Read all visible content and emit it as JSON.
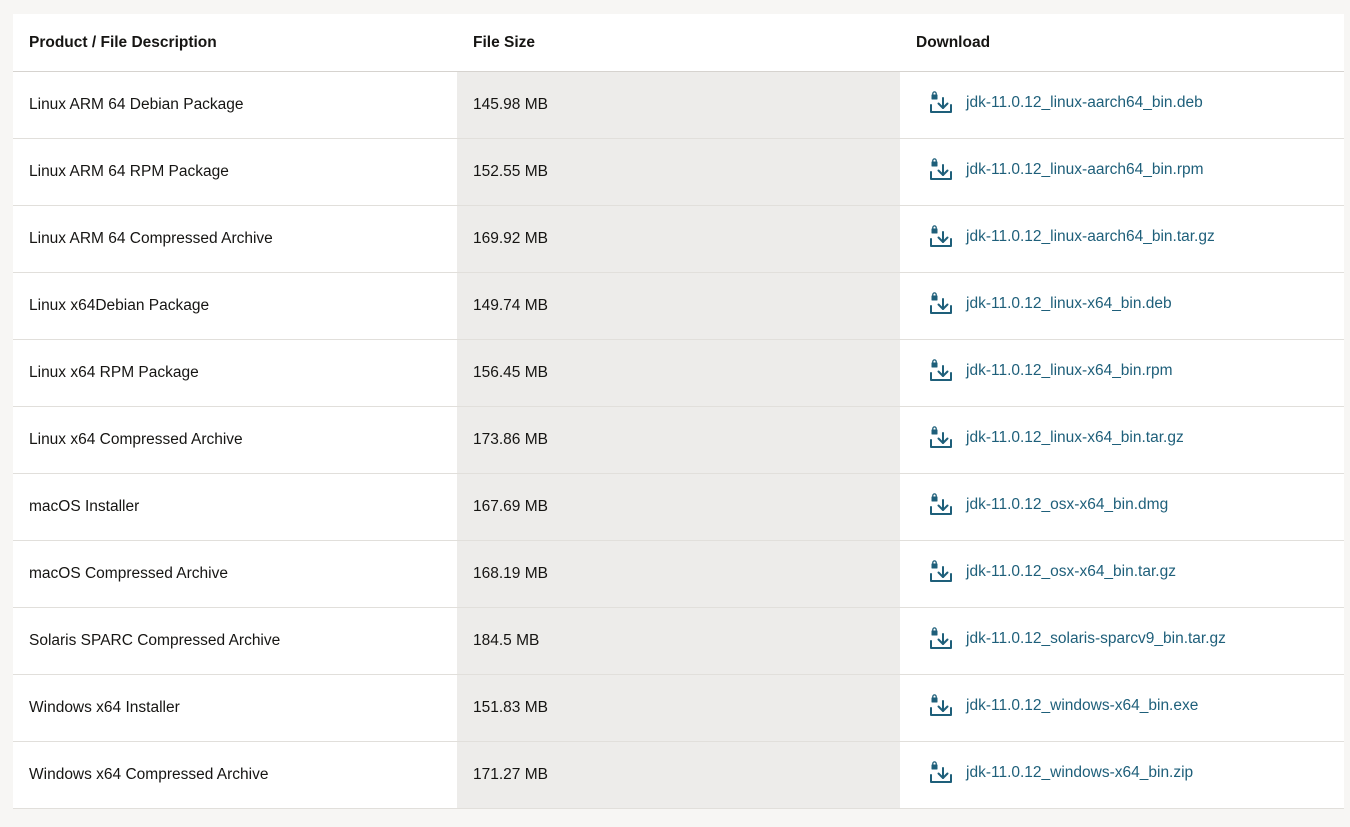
{
  "table": {
    "headers": {
      "description": "Product / File Description",
      "size": "File Size",
      "download": "Download"
    },
    "rows": [
      {
        "description": "Linux ARM 64 Debian Package",
        "size": "145.98 MB",
        "file": "jdk-11.0.12_linux-aarch64_bin.deb"
      },
      {
        "description": "Linux ARM 64 RPM Package",
        "size": "152.55 MB",
        "file": "jdk-11.0.12_linux-aarch64_bin.rpm"
      },
      {
        "description": "Linux ARM 64 Compressed Archive",
        "size": "169.92 MB",
        "file": "jdk-11.0.12_linux-aarch64_bin.tar.gz"
      },
      {
        "description": "Linux x64Debian Package",
        "size": "149.74 MB",
        "file": "jdk-11.0.12_linux-x64_bin.deb"
      },
      {
        "description": "Linux x64 RPM Package",
        "size": "156.45 MB",
        "file": "jdk-11.0.12_linux-x64_bin.rpm"
      },
      {
        "description": "Linux x64 Compressed Archive",
        "size": "173.86 MB",
        "file": "jdk-11.0.12_linux-x64_bin.tar.gz"
      },
      {
        "description": "macOS Installer",
        "size": "167.69 MB",
        "file": "jdk-11.0.12_osx-x64_bin.dmg"
      },
      {
        "description": "macOS Compressed Archive",
        "size": "168.19 MB",
        "file": "jdk-11.0.12_osx-x64_bin.tar.gz"
      },
      {
        "description": "Solaris SPARC Compressed Archive",
        "size": "184.5 MB",
        "file": "jdk-11.0.12_solaris-sparcv9_bin.tar.gz"
      },
      {
        "description": "Windows x64 Installer",
        "size": "151.83 MB",
        "file": "jdk-11.0.12_windows-x64_bin.exe"
      },
      {
        "description": "Windows x64 Compressed Archive",
        "size": "171.27 MB",
        "file": "jdk-11.0.12_windows-x64_bin.zip"
      }
    ]
  },
  "icons": {
    "download": "download-lock-icon"
  },
  "colors": {
    "link": "#1e5f7a",
    "size_column_bg": "#edecea",
    "page_bg": "#f7f6f4"
  }
}
